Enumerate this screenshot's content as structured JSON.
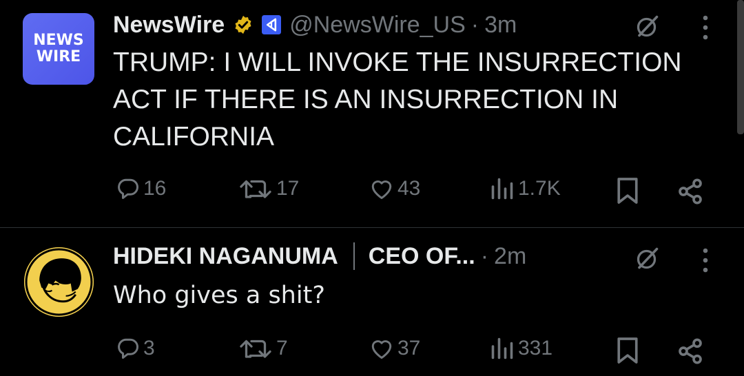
{
  "tweets": [
    {
      "avatar_text_line1": "NEWS",
      "avatar_text_line2": "WIRE",
      "name": "NewsWire",
      "verified": true,
      "handle": "@NewsWire_US",
      "separator": "·",
      "time": "3m",
      "text": "TRUMP: I WILL INVOKE THE INSURRECTION ACT IF THERE IS AN INSURRECTION IN CALIFORNIA",
      "replies": "16",
      "reposts": "17",
      "likes": "43",
      "views": "1.7K"
    },
    {
      "name": "HIDEKI NAGANUMA",
      "affiliation": "CEO OF...",
      "separator": "·",
      "time": "2m",
      "text": "Who gives a shit?",
      "replies": "3",
      "reposts": "7",
      "likes": "37",
      "views": "331"
    }
  ],
  "colors": {
    "background": "#000000",
    "text": "#e7e9ea",
    "muted": "#71767b",
    "verified_badge": "#e2b719",
    "avatar_newswire": "#5a63f0",
    "avatar_hideki": "#f2cf4e"
  },
  "icons": [
    "reply-icon",
    "repost-icon",
    "like-icon",
    "views-icon",
    "bookmark-icon",
    "share-icon",
    "grok-icon",
    "more-icon",
    "verified-badge-icon",
    "affiliate-icon"
  ]
}
